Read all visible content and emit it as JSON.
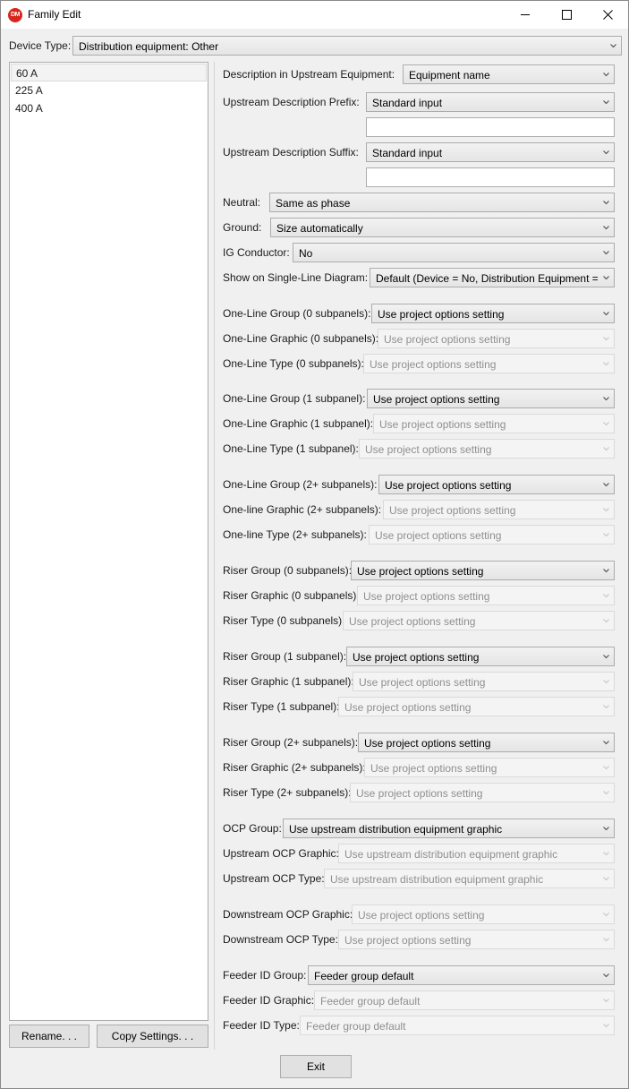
{
  "window": {
    "title": "Family Edit",
    "app_icon_text": "DM",
    "controls": [
      "minimize-icon",
      "maximize-icon",
      "close-icon"
    ]
  },
  "device_type": {
    "label": "Device Type:",
    "value": "Distribution equipment: Other"
  },
  "families": [
    "60 A",
    "225 A",
    "400 A"
  ],
  "buttons": {
    "rename": "Rename. . .",
    "copy_settings": "Copy Settings. . .",
    "exit": "Exit"
  },
  "fields": {
    "desc_upstream": {
      "label": "Description in Upstream Equipment:",
      "value": "Equipment name"
    },
    "upstream_prefix": {
      "label": "Upstream Description Prefix:",
      "value": "Standard input",
      "text": ""
    },
    "upstream_suffix": {
      "label": "Upstream Description Suffix:",
      "value": "Standard input",
      "text": ""
    },
    "neutral": {
      "label": "Neutral:",
      "value": "Same as phase"
    },
    "ground": {
      "label": "Ground:",
      "value": "Size automatically"
    },
    "ig_conductor": {
      "label": "IG Conductor:",
      "value": "No"
    },
    "show_sld": {
      "label": "Show on Single-Line Diagram:",
      "value": "Default (Device = No, Distribution Equipment = Yes)"
    },
    "ol_group_0": {
      "label": "One-Line Group (0 subpanels):",
      "value": "Use project options setting"
    },
    "ol_graphic_0": {
      "label": "One-Line Graphic (0 subpanels):",
      "value": "Use project options setting"
    },
    "ol_type_0": {
      "label": "One-Line Type (0 subpanels):",
      "value": "Use project options setting"
    },
    "ol_group_1": {
      "label": "One-Line Group (1 subpanel):",
      "value": "Use project options setting"
    },
    "ol_graphic_1": {
      "label": "One-Line Graphic (1 subpanel):",
      "value": "Use project options setting"
    },
    "ol_type_1": {
      "label": "One-Line Type (1 subpanel):",
      "value": "Use project options setting"
    },
    "ol_group_2": {
      "label": "One-Line Group (2+ subpanels):",
      "value": "Use project options setting"
    },
    "ol_graphic_2": {
      "label": "One-line Graphic (2+ subpanels):",
      "value": "Use project options setting"
    },
    "ol_type_2": {
      "label": "One-line Type (2+ subpanels):",
      "value": "Use project options setting"
    },
    "r_group_0": {
      "label": "Riser Group (0 subpanels):",
      "value": "Use project options setting"
    },
    "r_graphic_0": {
      "label": "Riser Graphic (0 subpanels):",
      "value": "Use project options setting"
    },
    "r_type_0": {
      "label": "Riser Type (0 subpanels):",
      "value": "Use project options setting"
    },
    "r_group_1": {
      "label": "Riser Group (1 subpanel):",
      "value": "Use project options setting"
    },
    "r_graphic_1": {
      "label": "Riser Graphic (1 subpanel):",
      "value": "Use project options setting"
    },
    "r_type_1": {
      "label": "Riser Type (1 subpanel):",
      "value": "Use project options setting"
    },
    "r_group_2": {
      "label": "Riser Group (2+ subpanels):",
      "value": "Use project options setting"
    },
    "r_graphic_2": {
      "label": "Riser Graphic (2+ subpanels):",
      "value": "Use project options setting"
    },
    "r_type_2": {
      "label": "Riser Type (2+ subpanels):",
      "value": "Use project options setting"
    },
    "ocp_group": {
      "label": "OCP Group:",
      "value": "Use upstream distribution equipment graphic"
    },
    "up_ocp_graphic": {
      "label": "Upstream OCP Graphic:",
      "value": "Use upstream distribution equipment graphic"
    },
    "up_ocp_type": {
      "label": "Upstream OCP Type:",
      "value": "Use upstream distribution equipment graphic"
    },
    "down_ocp_graphic": {
      "label": "Downstream OCP Graphic:",
      "value": "Use project options setting"
    },
    "down_ocp_type": {
      "label": "Downstream OCP Type:",
      "value": "Use project options setting"
    },
    "feeder_group": {
      "label": "Feeder ID Group:",
      "value": "Feeder group default"
    },
    "feeder_graphic": {
      "label": "Feeder ID Graphic:",
      "value": "Feeder group default"
    },
    "feeder_type": {
      "label": "Feeder ID Type:",
      "value": "Feeder group default"
    }
  }
}
